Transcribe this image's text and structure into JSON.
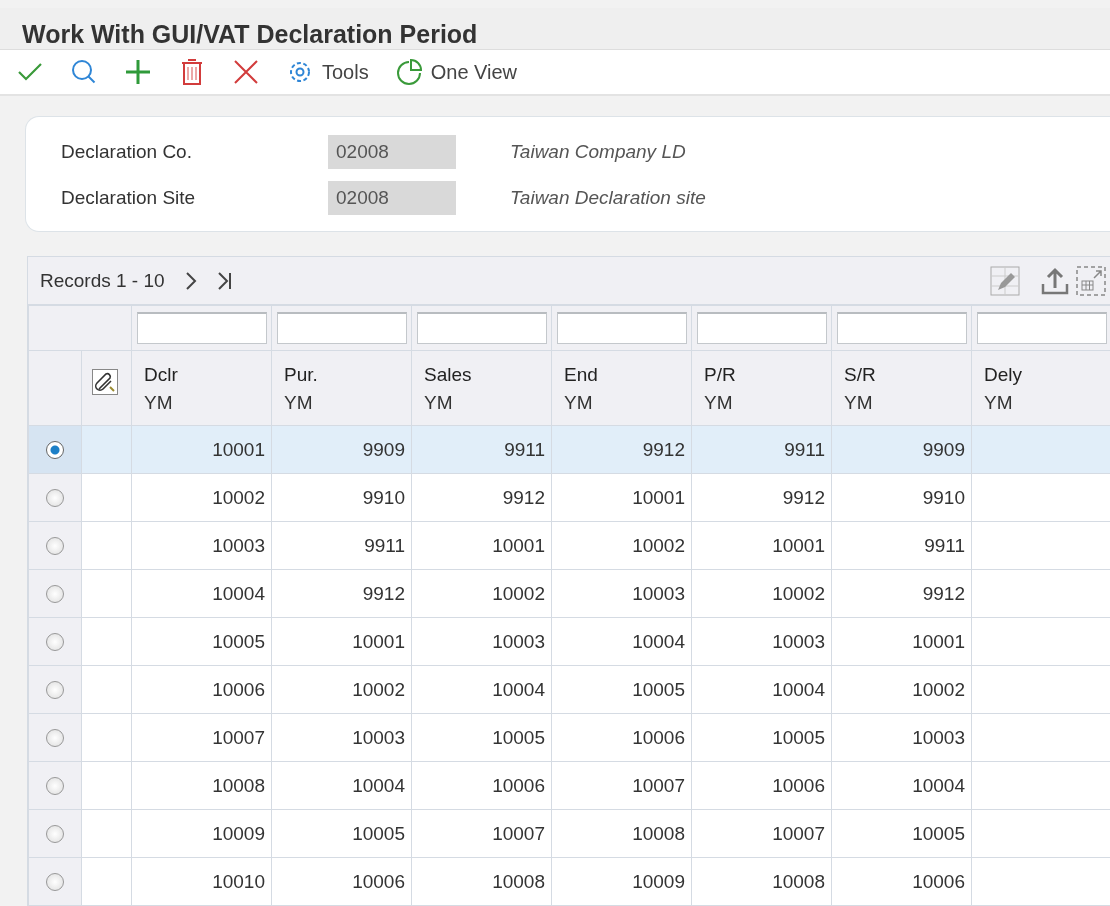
{
  "window": {
    "title": "Work With GUI/VAT Declaration Period"
  },
  "toolbar": [
    {
      "kind": "select"
    },
    {
      "kind": "find"
    },
    {
      "kind": "add"
    },
    {
      "kind": "delete"
    },
    {
      "kind": "close"
    },
    {
      "kind": "tools",
      "label": "Tools"
    },
    {
      "kind": "oneview",
      "label": "One View"
    }
  ],
  "header": {
    "fields": [
      {
        "label": "Declaration Co.",
        "value": "02008",
        "disabled": true,
        "description": "Taiwan Company LD"
      },
      {
        "label": "Declaration Site",
        "value": "02008",
        "disabled": true,
        "description": "Taiwan Declaration site"
      }
    ]
  },
  "grid": {
    "records": "Records 1 - 10",
    "columns": [
      {
        "lines": [
          "Dclr",
          "YM"
        ]
      },
      {
        "lines": [
          "Pur.",
          "YM"
        ]
      },
      {
        "lines": [
          "Sales",
          "YM"
        ]
      },
      {
        "lines": [
          "End",
          "YM"
        ]
      },
      {
        "lines": [
          "P/R",
          "YM"
        ]
      },
      {
        "lines": [
          "S/R",
          "YM"
        ]
      },
      {
        "lines": [
          "Dely",
          "YM"
        ]
      }
    ],
    "rows": [
      {
        "selected": true,
        "cells": [
          "10001",
          "9909",
          "9911",
          "9912",
          "9911",
          "9909"
        ]
      },
      {
        "selected": false,
        "cells": [
          "10002",
          "9910",
          "9912",
          "10001",
          "9912",
          "9910"
        ]
      },
      {
        "selected": false,
        "cells": [
          "10003",
          "9911",
          "10001",
          "10002",
          "10001",
          "9911"
        ]
      },
      {
        "selected": false,
        "cells": [
          "10004",
          "9912",
          "10002",
          "10003",
          "10002",
          "9912"
        ]
      },
      {
        "selected": false,
        "cells": [
          "10005",
          "10001",
          "10003",
          "10004",
          "10003",
          "10001"
        ]
      },
      {
        "selected": false,
        "cells": [
          "10006",
          "10002",
          "10004",
          "10005",
          "10004",
          "10002"
        ]
      },
      {
        "selected": false,
        "cells": [
          "10007",
          "10003",
          "10005",
          "10006",
          "10005",
          "10003"
        ]
      },
      {
        "selected": false,
        "cells": [
          "10008",
          "10004",
          "10006",
          "10007",
          "10006",
          "10004"
        ]
      },
      {
        "selected": false,
        "cells": [
          "10009",
          "10005",
          "10007",
          "10008",
          "10007",
          "10005"
        ]
      },
      {
        "selected": false,
        "cells": [
          "10010",
          "10006",
          "10008",
          "10009",
          "10008",
          "10006"
        ]
      }
    ]
  }
}
